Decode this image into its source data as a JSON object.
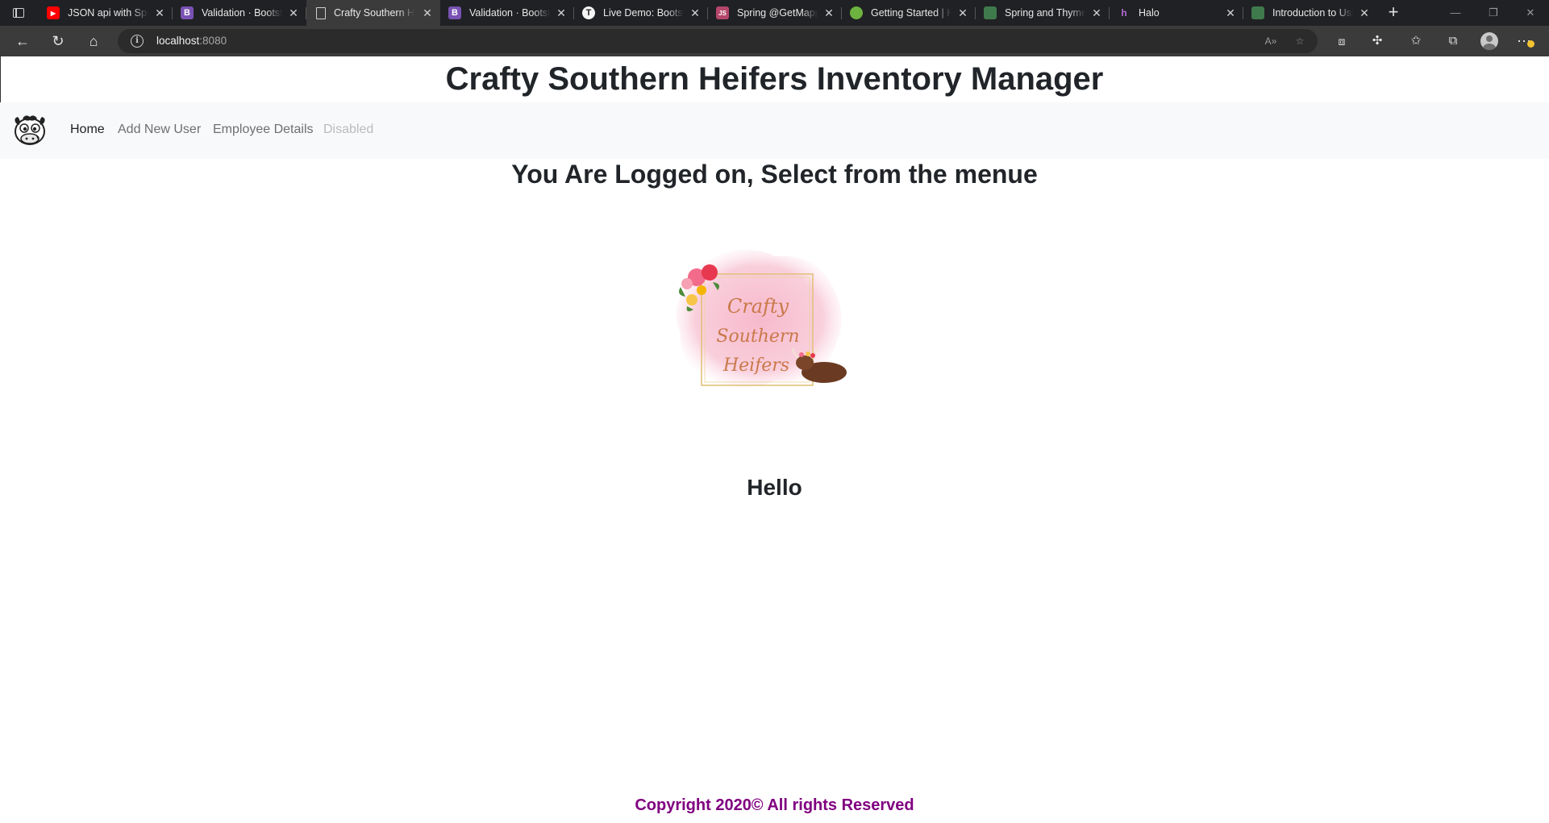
{
  "browser": {
    "tabs": [
      {
        "title": "JSON api with Spri",
        "icon": "youtube-icon",
        "color": "#ff0000"
      },
      {
        "title": "Validation · Bootstr",
        "icon": "bootstrap-icon",
        "color": "#7952b3",
        "glyph": "B"
      },
      {
        "title": "Crafty Southern He",
        "icon": "page-icon",
        "active": true
      },
      {
        "title": "Validation · Bootstr",
        "icon": "bootstrap-icon",
        "color": "#7952b3",
        "glyph": "B"
      },
      {
        "title": "Live Demo: Bootstr",
        "icon": "t-icon",
        "color": "#f5f5f5",
        "glyph": "T"
      },
      {
        "title": "Spring @GetMappi",
        "icon": "spring-js-icon",
        "color": "#b5476b"
      },
      {
        "title": "Getting Started | H",
        "icon": "leaf-icon",
        "color": "#6db33f"
      },
      {
        "title": "Spring and Thymel",
        "icon": "leaf-icon",
        "color": "#6db33f"
      },
      {
        "title": "Halo",
        "icon": "halo-icon",
        "color": "#9b59b6"
      },
      {
        "title": "Introduction to Usi",
        "icon": "leaf-icon",
        "color": "#6db33f"
      }
    ],
    "url_host": "localhost",
    "url_port": ":8080"
  },
  "page": {
    "title": "Crafty Southern Heifers Inventory Manager",
    "nav": {
      "home": "Home",
      "add_user": "Add New User",
      "employee_details": "Employee Details",
      "disabled": "Disabled"
    },
    "heading": "You Are Logged on, Select from the menue",
    "logo_text": {
      "line1": "Crafty",
      "line2": "Southern",
      "line3": "Heifers"
    },
    "hello": "Hello",
    "footer": "Copyright 2020© All rights Reserved"
  },
  "colors": {
    "footer": "#800080",
    "navbar_bg": "#f8f9fa",
    "tab_strip": "#202124",
    "toolbar": "#3b3b3b"
  }
}
